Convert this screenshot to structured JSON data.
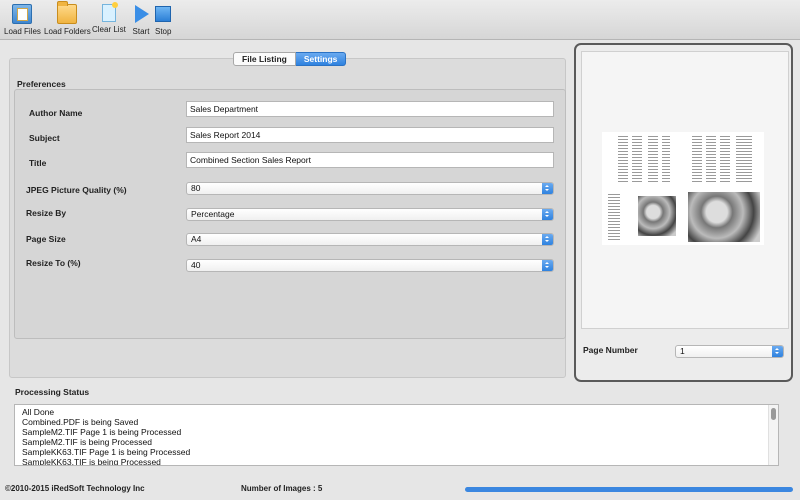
{
  "toolbar": {
    "buttons": [
      {
        "label": "Load Files",
        "icon": "load-files-icon"
      },
      {
        "label": "Load Folders",
        "icon": "folder-icon"
      },
      {
        "label": "Clear List",
        "icon": "clear-list-icon"
      },
      {
        "label": "Start",
        "icon": "play-icon"
      },
      {
        "label": "Stop",
        "icon": "stop-icon"
      }
    ]
  },
  "tabs": [
    {
      "label": "File Listing",
      "active": false
    },
    {
      "label": "Settings",
      "active": true
    }
  ],
  "preferences": {
    "title": "Preferences",
    "author": {
      "label": "Author Name",
      "value": "Sales Department"
    },
    "subject": {
      "label": "Subject",
      "value": "Sales Report 2014"
    },
    "doc_title": {
      "label": "Title",
      "value": "Combined Section Sales Report"
    },
    "jpeg_quality": {
      "label": "JPEG Picture Quality (%)",
      "value": "80"
    },
    "resize_by": {
      "label": "Resize By",
      "value": "Percentage"
    },
    "page_size": {
      "label": "Page Size",
      "value": "A4"
    },
    "resize_to": {
      "label": "Resize To (%)",
      "value": "40"
    }
  },
  "preview": {
    "page_number_label": "Page Number",
    "page_number_value": "1"
  },
  "processing": {
    "title": "Processing Status",
    "lines": [
      "All Done",
      "Combined.PDF is being Saved",
      "SampleM2.TIF Page 1 is being Processed",
      "SampleM2.TIF is being Processed",
      "SampleKK63.TIF Page 1 is being Processed",
      "SampleKK63.TIF is being Processed"
    ]
  },
  "footer": {
    "copyright": "©2010-2015 iRedSoft Technology Inc",
    "image_count": "Number of Images : 5",
    "progress_fraction": 1.0
  },
  "colors": {
    "accent": "#2f82df",
    "progress": "#3b87e0"
  }
}
